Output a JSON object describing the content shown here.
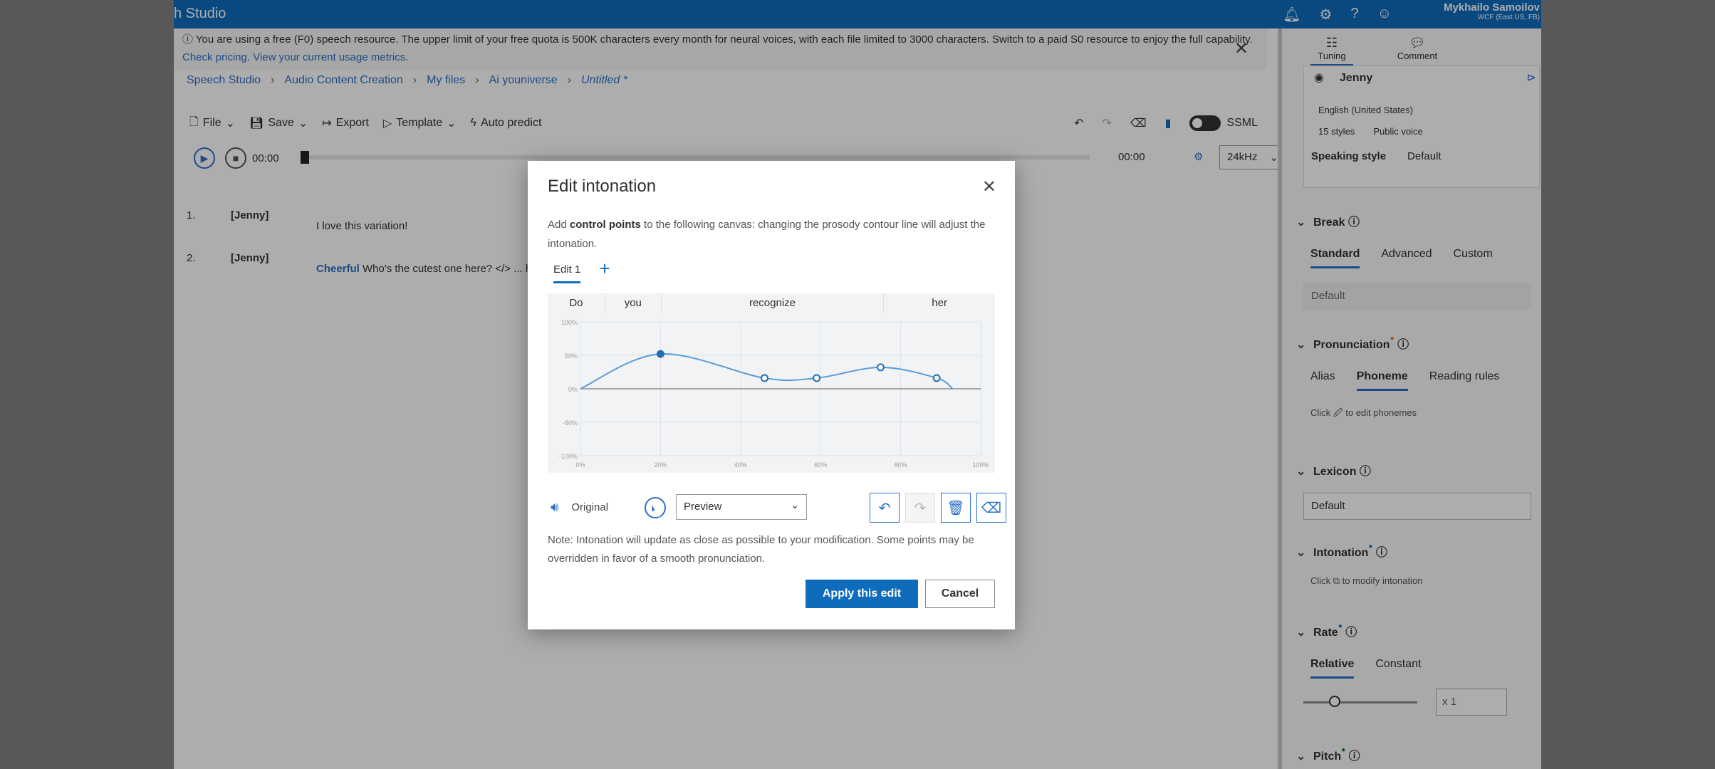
{
  "app": {
    "title": "h Studio",
    "user_name": "Mykhailo Samoilov",
    "user_tenant": "WCF (East US, FB)"
  },
  "notice": {
    "text": "ⓘ You are using a free (F0) speech resource. The upper limit of your free quota is 500K characters every month for neural voices, with each file limited to 3000 characters. Switch to a paid S0 resource to enjoy the full capability. ",
    "link1": "Check pricing.",
    "link2": "View your current usage metrics."
  },
  "breadcrumb": [
    "Speech Studio",
    "Audio Content Creation",
    "My files",
    "Ai youniverse",
    "Untitled *"
  ],
  "toolbar": {
    "file": "File",
    "save": "Save",
    "export": "Export",
    "template": "Template",
    "auto_predict": "Auto predict",
    "ssml": "SSML"
  },
  "player": {
    "start_time": "00:00",
    "end_time": "00:00",
    "sample_rate": "24kHz"
  },
  "script_lines": [
    {
      "num": "1.",
      "speaker": "[Jenny]",
      "tag": "",
      "text": "I love this variation!"
    },
    {
      "num": "2.",
      "speaker": "[Jenny]",
      "tag": "Cheerful",
      "text": "Who's the cutest one here? </> ... her resolution, then download it to your computer."
    }
  ],
  "panel": {
    "tab_tuning": "Tuning",
    "tab_comment": "Comment",
    "voice_name": "Jenny",
    "voice_lang": "English (United States)",
    "voice_styles": "15 styles",
    "voice_type": "Public voice",
    "speaking_style_label": "Speaking style",
    "speaking_style_value": "Default",
    "break_label": "Break",
    "break_tabs": [
      "Standard",
      "Advanced",
      "Custom"
    ],
    "break_value": "Default",
    "pron_label": "Pronunciation",
    "pron_tabs": [
      "Alias",
      "Phoneme",
      "Reading rules"
    ],
    "pron_hint": "Click 🖉 to edit phonemes",
    "lexicon_label": "Lexicon",
    "lexicon_value": "Default",
    "inton_label": "Intonation",
    "inton_hint": "Click ⧉ to modify intonation",
    "rate_label": "Rate",
    "rate_tabs": [
      "Relative",
      "Constant"
    ],
    "rate_value": "x 1",
    "pitch_label": "Pitch"
  },
  "modal": {
    "title": "Edit intonation",
    "desc_pre": "Add ",
    "desc_bold": "control points",
    "desc_post": " to the following canvas: changing the prosody contour line will adjust the intonation.",
    "tab": "Edit 1",
    "words": [
      "Do",
      "you",
      "recognize",
      "her"
    ],
    "original_label": "Original",
    "dropdown_value": "Preview",
    "note": "Note: Intonation will update as close as possible to your modification. Some points may be overridden in favor of a smooth pronunciation.",
    "apply": "Apply this edit",
    "cancel": "Cancel"
  },
  "chart_data": {
    "type": "line",
    "y_ticks": [
      "100%",
      "50%",
      "0%",
      "-50%",
      "-100%"
    ],
    "x_ticks": [
      "0%",
      "20%",
      "40%",
      "60%",
      "80%",
      "100%"
    ],
    "ylim": [
      -100,
      100
    ],
    "xlim": [
      0,
      100
    ],
    "control_points": [
      {
        "x": 20,
        "y": 52
      },
      {
        "x": 46,
        "y": 16
      },
      {
        "x": 59,
        "y": 16
      },
      {
        "x": 75,
        "y": 32
      },
      {
        "x": 89,
        "y": 16
      }
    ],
    "curve": [
      {
        "x": 0,
        "y": 0
      },
      {
        "x": 20,
        "y": 52
      },
      {
        "x": 46,
        "y": 16
      },
      {
        "x": 59,
        "y": 16
      },
      {
        "x": 75,
        "y": 32
      },
      {
        "x": 89,
        "y": 16
      },
      {
        "x": 93,
        "y": 0
      }
    ],
    "line_color": "#5b9bd5"
  }
}
